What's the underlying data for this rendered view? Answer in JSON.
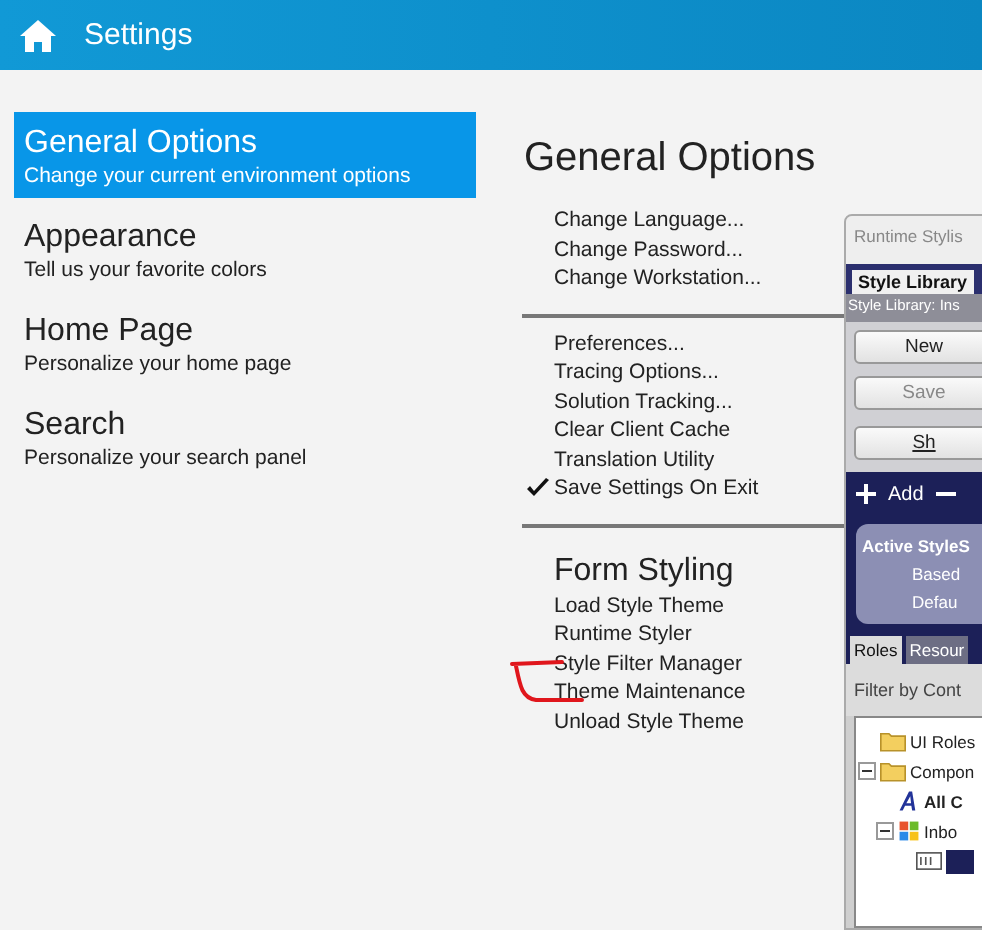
{
  "window": {
    "title": "Settings"
  },
  "sidebar": {
    "items": [
      {
        "title": "General Options",
        "subtitle": "Change your current environment options",
        "selected": true
      },
      {
        "title": "Appearance",
        "subtitle": "Tell us your favorite colors",
        "selected": false
      },
      {
        "title": "Home Page",
        "subtitle": "Personalize your home page",
        "selected": false
      },
      {
        "title": "Search",
        "subtitle": "Personalize your search panel",
        "selected": false
      }
    ]
  },
  "main": {
    "heading": "General Options",
    "groups": [
      {
        "items": [
          {
            "label": "Change Language...",
            "checked": false
          },
          {
            "label": "Change Password...",
            "checked": false
          },
          {
            "label": "Change Workstation...",
            "checked": false
          }
        ]
      },
      {
        "items": [
          {
            "label": "Preferences...",
            "checked": false
          },
          {
            "label": "Tracing Options...",
            "checked": false
          },
          {
            "label": "Solution Tracking...",
            "checked": false
          },
          {
            "label": "Clear Client Cache",
            "checked": false
          },
          {
            "label": "Translation Utility",
            "checked": false
          },
          {
            "label": "Save Settings On Exit",
            "checked": true
          }
        ]
      },
      {
        "heading": "Form Styling",
        "items": [
          {
            "label": "Load Style Theme",
            "checked": false
          },
          {
            "label": "Runtime Styler",
            "checked": false
          },
          {
            "label": "Style Filter Manager",
            "checked": false
          },
          {
            "label": "Theme Maintenance",
            "checked": false
          },
          {
            "label": "Unload Style Theme",
            "checked": false
          }
        ]
      }
    ]
  },
  "runtime_stylist": {
    "title": "Runtime Stylis",
    "tabs": [
      {
        "label": "Style Library",
        "selected": true
      }
    ],
    "library_label": "Style Library: Ins",
    "buttons": [
      {
        "label": "New",
        "disabled": false
      },
      {
        "label": "Save",
        "disabled": true
      },
      {
        "label": "Sh",
        "disabled": false
      }
    ],
    "add_label": "Add",
    "active_style": [
      "Active StyleS",
      "Based",
      "Defau"
    ],
    "role_tabs": [
      {
        "label": "Roles",
        "selected": true
      },
      {
        "label": "Resour",
        "selected": false
      }
    ],
    "filter_label": "Filter by Cont",
    "tree": [
      {
        "label": "UI Roles",
        "kind": "folder"
      },
      {
        "label": "Compon",
        "kind": "folder",
        "expanded": true,
        "children": [
          {
            "label": "All C",
            "kind": "font",
            "bold": true
          },
          {
            "label": "Inbo",
            "kind": "windows",
            "expanded": true,
            "children": [
              {
                "kind": "textbox",
                "selected": true
              }
            ]
          }
        ]
      }
    ]
  }
}
